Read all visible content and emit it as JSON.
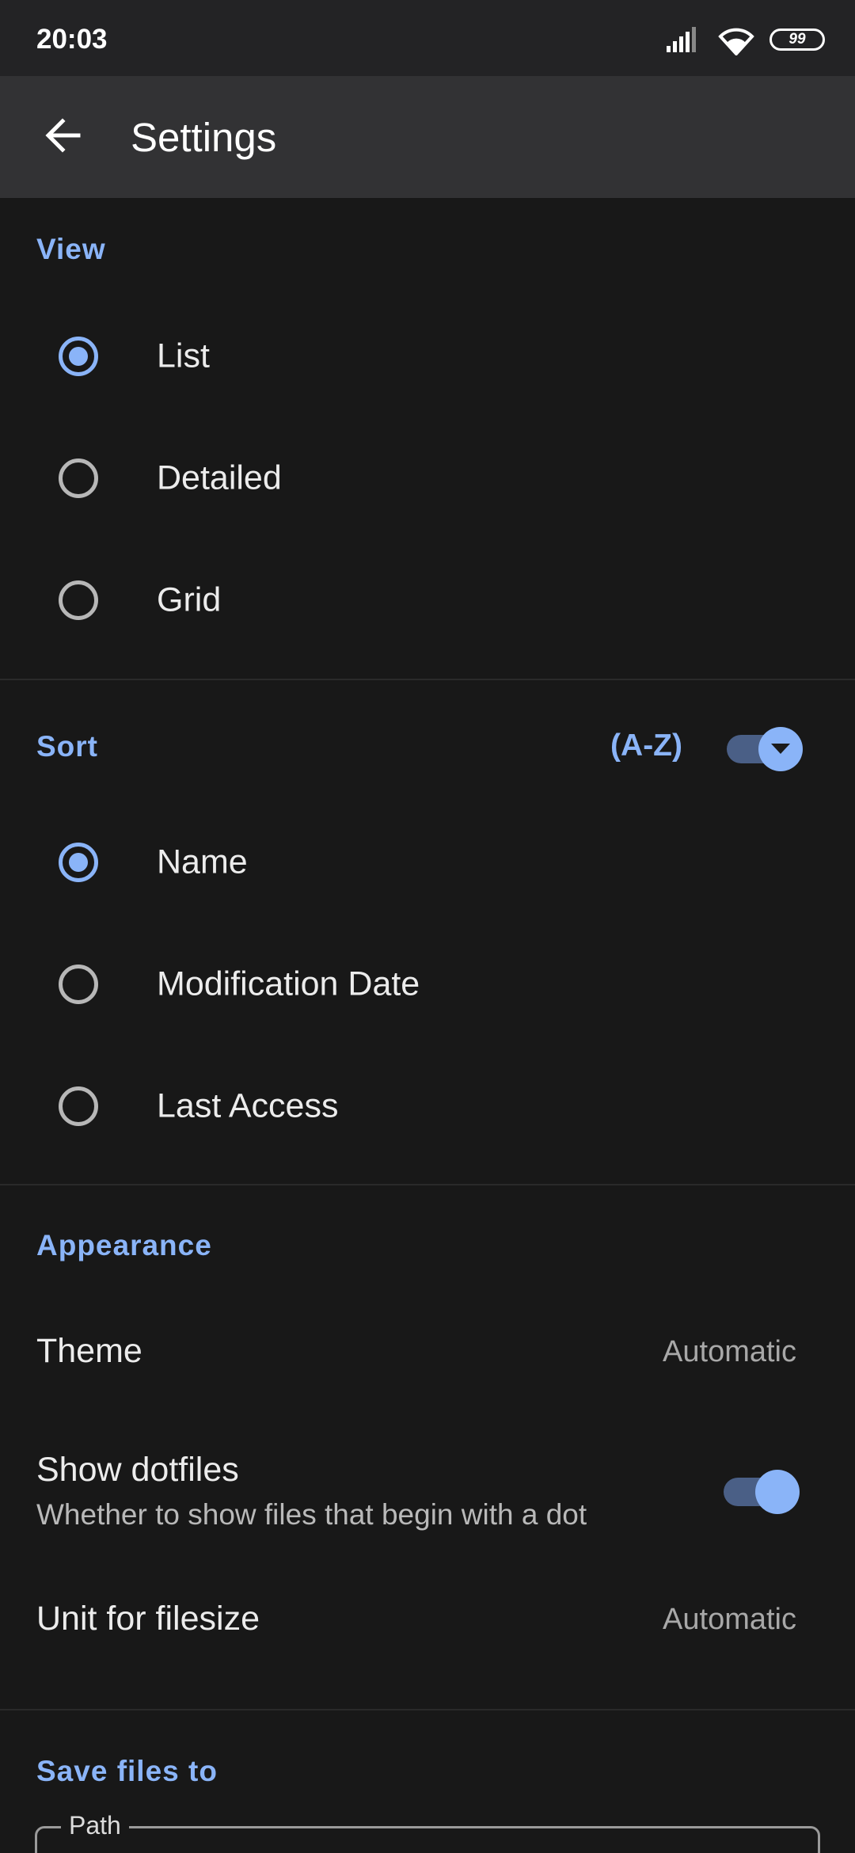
{
  "status_bar": {
    "time": "20:03",
    "battery_level": "99"
  },
  "app_bar": {
    "title": "Settings",
    "back_icon": "arrow-left-icon"
  },
  "accent_color": "#8ab4f8",
  "view": {
    "header": "View",
    "options": [
      {
        "label": "List",
        "selected": true
      },
      {
        "label": "Detailed",
        "selected": false
      },
      {
        "label": "Grid",
        "selected": false
      }
    ]
  },
  "sort": {
    "header": "Sort",
    "order_label": "(A-Z)",
    "order_toggle_on": true,
    "options": [
      {
        "label": "Name",
        "selected": true
      },
      {
        "label": "Modification Date",
        "selected": false
      },
      {
        "label": "Last Access",
        "selected": false
      }
    ]
  },
  "appearance": {
    "header": "Appearance",
    "theme": {
      "title": "Theme",
      "value": "Automatic"
    },
    "dotfiles": {
      "title": "Show dotfiles",
      "summary": "Whether to show files that begin with a dot",
      "enabled": true
    },
    "filesize_unit": {
      "title": "Unit for filesize",
      "value": "Automatic"
    }
  },
  "save_files": {
    "header": "Save files to",
    "path_label": "Path"
  }
}
